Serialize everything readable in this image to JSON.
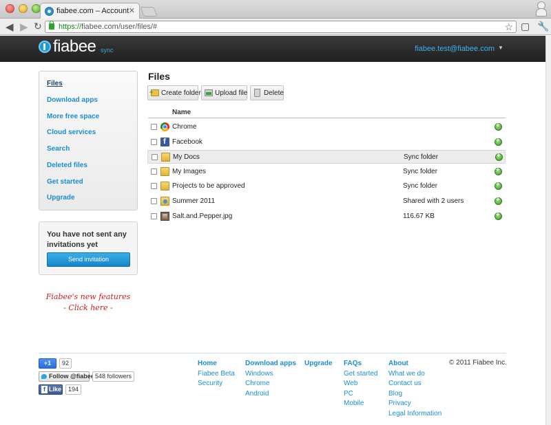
{
  "browser": {
    "tab_title": "fiabee.com – Account",
    "url_scheme": "https://",
    "url_rest": "fiabee.com/user/files/#",
    "profile_icon": "person-icon"
  },
  "header": {
    "logo_text": "fiabee",
    "logo_sub": "sync",
    "user_email": "fiabee.test@fiabee.com",
    "caret": "▼",
    "bg_color": "#262626",
    "accent_color": "#3db4ea"
  },
  "sidebar": {
    "items": [
      {
        "label": "Files",
        "active": true
      },
      {
        "label": "Download apps",
        "active": false
      },
      {
        "label": "More free space",
        "active": false
      },
      {
        "label": "Cloud services",
        "active": false
      },
      {
        "label": "Search",
        "active": false
      },
      {
        "label": "Deleted files",
        "active": false
      },
      {
        "label": "Get started",
        "active": false
      },
      {
        "label": "Upgrade",
        "active": false
      }
    ],
    "invite_text": "You have not sent any invitations yet",
    "invite_button": "Send invitation",
    "handwritten_line1": "Fiabee's new features",
    "handwritten_line2": "- Click here -"
  },
  "main": {
    "title": "Files",
    "toolbar": {
      "create_folder": "Create folder",
      "upload_file": "Upload file",
      "delete": "Delete"
    },
    "column_name": "Name",
    "files": [
      {
        "name": "Chrome",
        "status": "",
        "icon": "chrome-icon"
      },
      {
        "name": "Facebook",
        "status": "",
        "icon": "facebook-icon"
      },
      {
        "name": "My Docs",
        "status": "Sync folder",
        "icon": "folder-icon",
        "highlighted": true
      },
      {
        "name": "My Images",
        "status": "Sync folder",
        "icon": "folder-icon"
      },
      {
        "name": "Projects to be approved",
        "status": "Sync folder",
        "icon": "folder-icon"
      },
      {
        "name": "Summer 2011",
        "status": "Shared with 2 users",
        "icon": "shared-folder-icon"
      },
      {
        "name": "Salt.and.Pepper.jpg",
        "status": "116.67 KB",
        "icon": "image-file-icon"
      }
    ]
  },
  "footer": {
    "social": {
      "gplus_label": "+1",
      "gplus_count": "92",
      "twitter_label": "Follow @fiabee",
      "twitter_count": "548 followers",
      "facebook_label": "Like",
      "facebook_count": "194"
    },
    "columns": [
      {
        "head": "Home",
        "links": [
          "Fiabee Beta",
          "Security"
        ]
      },
      {
        "head": "Download apps",
        "links": [
          "Windows",
          "Chrome",
          "Android"
        ]
      },
      {
        "head": "Upgrade",
        "links": []
      },
      {
        "head": "FAQs",
        "links": [
          "Get started",
          "Web",
          "PC",
          "Mobile"
        ]
      },
      {
        "head": "About",
        "links": [
          "What we do",
          "Contact us",
          "Blog",
          "Privacy",
          "Legal Information"
        ]
      }
    ],
    "copyright": "© 2011 Fiabee Inc."
  }
}
